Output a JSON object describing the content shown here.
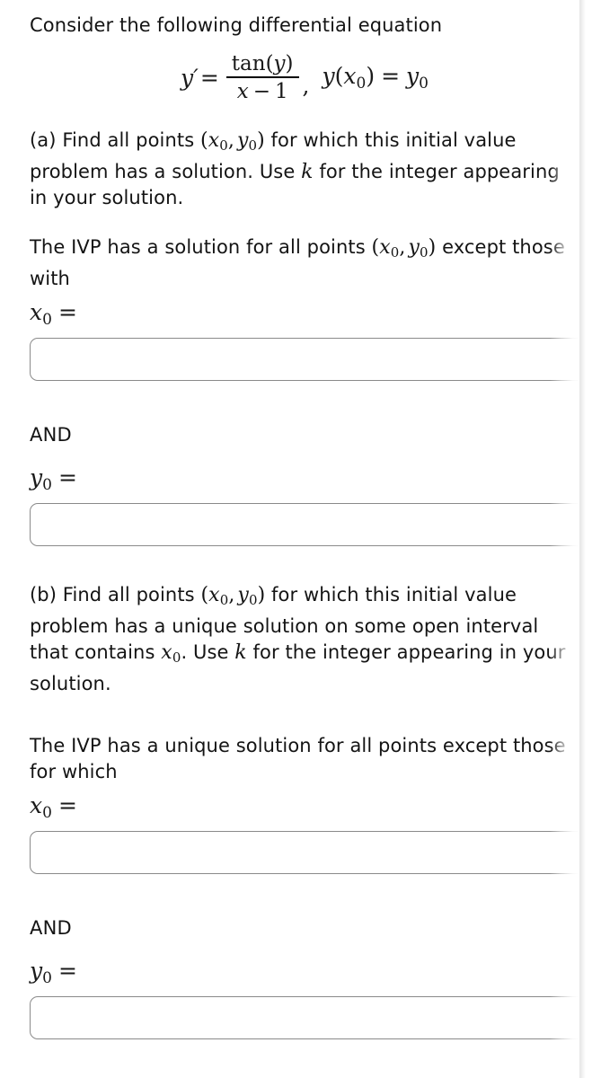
{
  "prompt": {
    "intro": "Consider the following differential equation"
  },
  "equation": {
    "lhs": "y",
    "prime": "′",
    "equals": "=",
    "numerator_fn": "tan",
    "numerator_arg": "y",
    "denominator_var": "x",
    "denominator_minus": "−",
    "denominator_num": "1",
    "comma": ",",
    "ic_fn": "y",
    "ic_arg_var": "x",
    "ic_arg_sub": "0",
    "ic_equals": "=",
    "ic_rhs_var": "y",
    "ic_rhs_sub": "0",
    "plain_text": "y' = tan(y)/(x - 1),  y(x0) = y0"
  },
  "part_a": {
    "question_line1_pre": "(a) Find all points ",
    "question_line1_post": " for which this initial value problem has a solution. Use ",
    "question_line1_k": "k",
    "question_line1_end": " for the integer appearing in your solution.",
    "statement_pre": "The IVP has a solution for all points ",
    "statement_post": " except those with",
    "x_label_var": "x",
    "x_label_sub": "0",
    "x_label_eq": "=",
    "and_label": "AND",
    "y_label_var": "y",
    "y_label_sub": "0",
    "y_label_eq": "=",
    "x_answer_value": "",
    "y_answer_value": ""
  },
  "part_b": {
    "question_line1_pre": "(b) Find all points ",
    "question_line1_mid": " for which this initial value problem has a unique solution on some open interval that contains ",
    "question_line1_x": "x",
    "question_line1_x_sub": "0",
    "question_line1_post": ". Use ",
    "question_line1_k": "k",
    "question_line1_end": " for the integer appearing in your solution.",
    "statement": "The IVP has a unique solution for all points except those for which",
    "x_label_var": "x",
    "x_label_sub": "0",
    "x_label_eq": "=",
    "and_label": "AND",
    "y_label_var": "y",
    "y_label_sub": "0",
    "y_label_eq": "=",
    "x_answer_value": "",
    "y_answer_value": ""
  },
  "point_notation": {
    "open_paren": "(",
    "x_var": "x",
    "x_sub": "0",
    "comma": ",",
    "y_var": "y",
    "y_sub": "0",
    "close_paren": ")"
  },
  "colors": {
    "page_background": "#ffffff",
    "text": "#141414",
    "input_border": "#8a8a8a",
    "edge_shadow": "#d9d9d9"
  }
}
